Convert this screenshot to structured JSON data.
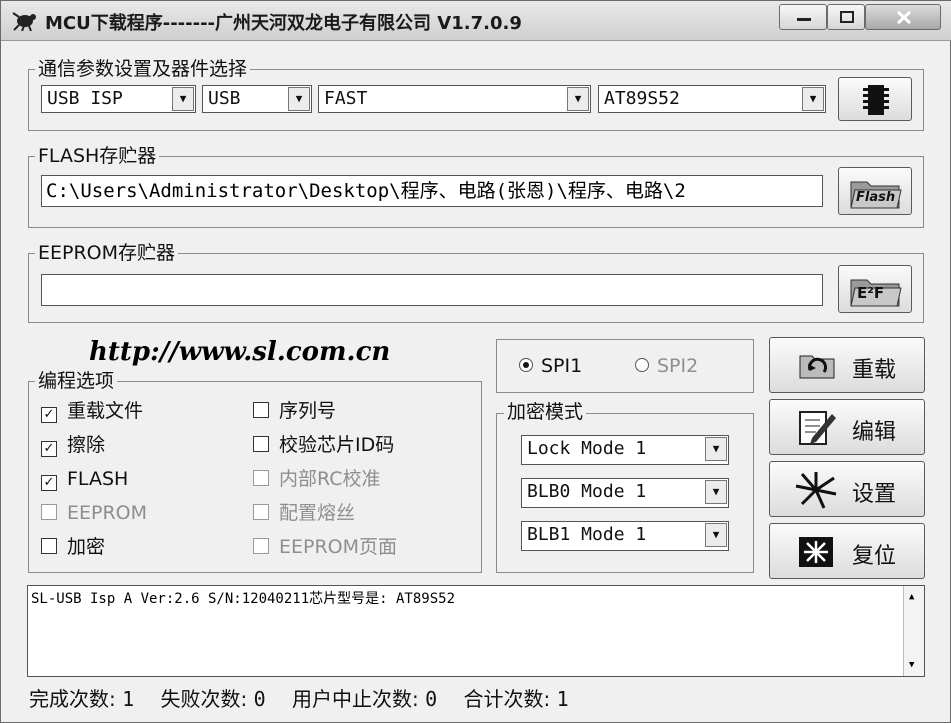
{
  "window": {
    "title": "MCU下载程序-------广州天河双龙电子有限公司 V1.7.0.9",
    "icon": "chip-bug-icon"
  },
  "comm": {
    "group_label": "通信参数设置及器件选择",
    "protocol": "USB ISP",
    "port": "USB",
    "speed": "FAST",
    "device": "AT89S52",
    "chip_button_icon": "chip-icon"
  },
  "flash": {
    "group_label": "FLASH存贮器",
    "path": "C:\\Users\\Administrator\\Desktop\\程序、电路(张恩)\\程序、电路\\2",
    "button_label": "Flash"
  },
  "eeprom": {
    "group_label": "EEPROM存贮器",
    "path": "",
    "button_label": "E²F"
  },
  "url": "http://www.sl.com.cn",
  "options": {
    "group_label": "编程选项",
    "left": [
      {
        "label": "重载文件",
        "checked": true,
        "enabled": true
      },
      {
        "label": "擦除",
        "checked": true,
        "enabled": true
      },
      {
        "label": "FLASH",
        "checked": true,
        "enabled": true
      },
      {
        "label": "EEPROM",
        "checked": false,
        "enabled": false
      },
      {
        "label": "加密",
        "checked": false,
        "enabled": true
      }
    ],
    "right": [
      {
        "label": "序列号",
        "checked": false,
        "enabled": true
      },
      {
        "label": "校验芯片ID码",
        "checked": false,
        "enabled": true
      },
      {
        "label": "内部RC校准",
        "checked": false,
        "enabled": false
      },
      {
        "label": "配置熔丝",
        "checked": false,
        "enabled": false
      },
      {
        "label": "EEPROM页面",
        "checked": false,
        "enabled": false
      }
    ]
  },
  "spi": {
    "spi1": "SPI1",
    "spi2": "SPI2",
    "selected": "SPI1"
  },
  "encryption": {
    "group_label": "加密模式",
    "lock_mode": "Lock Mode 1",
    "blb0_mode": "BLB0 Mode 1",
    "blb1_mode": "BLB1 Mode 1"
  },
  "actions": {
    "reload": "重载",
    "edit": "编辑",
    "settings": "设置",
    "reset": "复位"
  },
  "log": {
    "line1": "SL-USB Isp A Ver:2.6 S/N:12040211芯片型号是: AT89S52"
  },
  "status": {
    "done_label": "完成次数:",
    "done": "1",
    "fail_label": "失败次数:",
    "fail": "0",
    "abort_label": "用户中止次数:",
    "abort": "0",
    "total_label": "合计次数:",
    "total": "1"
  }
}
